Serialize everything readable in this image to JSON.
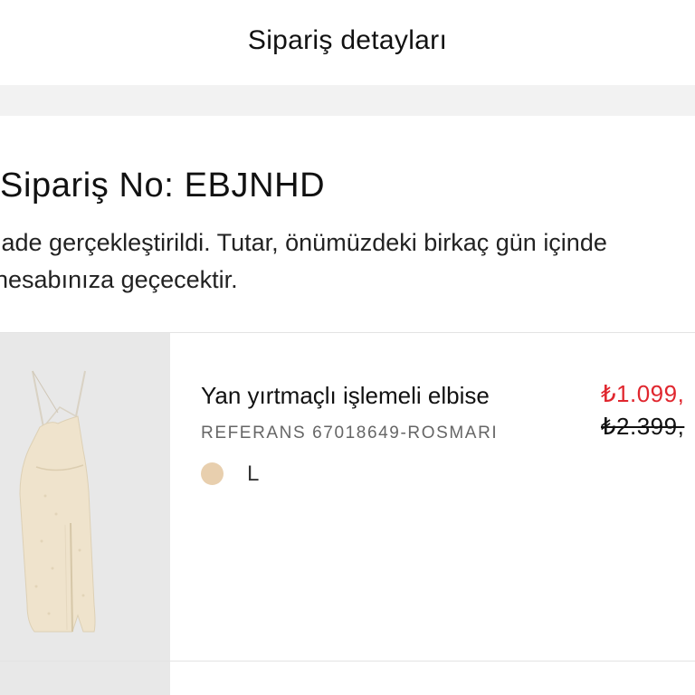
{
  "header": {
    "title": "Sipariş detayları"
  },
  "order": {
    "number_label": "Sipariş No: EBJNHD",
    "status_message": "İade gerçekleştirildi. Tutar, önümüzdeki birkaç gün içinde hesabınıza geçecektir."
  },
  "item": {
    "name": "Yan yırtmaçlı işlemeli elbise",
    "reference": "REFERANS 67018649-ROSMARI",
    "color_hex": "#e8cfae",
    "color_icon": "color-swatch-icon",
    "size": "L",
    "price_current": "₺1.099,",
    "price_original": "₺2.399,",
    "price_current_color": "#e0262e",
    "image_subject": "beige-midi-dress-image"
  }
}
